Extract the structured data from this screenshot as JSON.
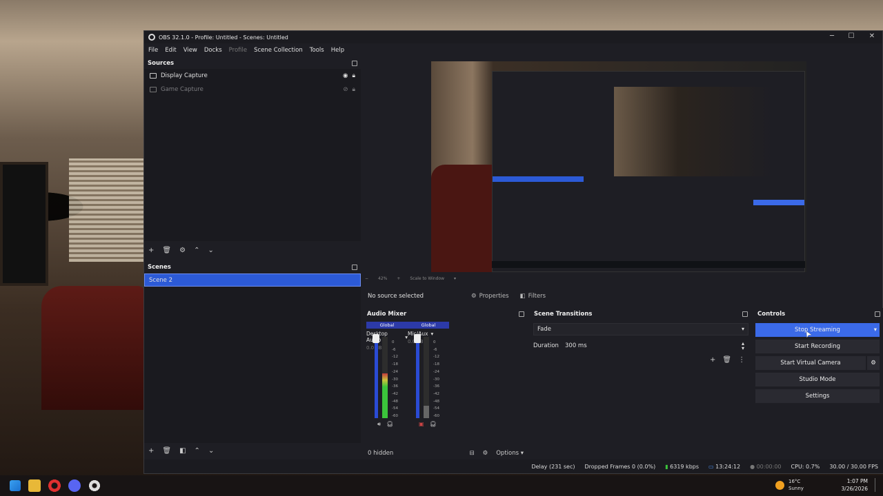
{
  "window": {
    "title": "OBS 32.1.0 - Profile: Untitled - Scenes: Untitled",
    "minimize": "─",
    "maximize": "☐",
    "close": "✕"
  },
  "menu": [
    "File",
    "Edit",
    "View",
    "Docks",
    "Profile",
    "Scene Collection",
    "Tools",
    "Help"
  ],
  "sources": {
    "title": "Sources",
    "items": [
      {
        "label": "Display Capture",
        "icon": "monitor-icon",
        "visible": true
      },
      {
        "label": "Game Capture",
        "icon": "gamepad-icon",
        "visible": false
      }
    ]
  },
  "scenes": {
    "title": "Scenes",
    "items": [
      {
        "label": "Scene 2",
        "selected": true
      }
    ]
  },
  "preview": {
    "zoom": "42%",
    "scale_mode": "Scale to Window"
  },
  "context_bar": {
    "no_source": "No source selected",
    "properties": "Properties",
    "filters": "Filters"
  },
  "audio_mixer": {
    "title": "Audio Mixer",
    "channels": [
      {
        "global": "Global",
        "name": "Desktop Audio",
        "db": "0.0 dB",
        "level": 0.55
      },
      {
        "global": "Global",
        "name": "Mic/Aux",
        "db": "0.0 dB",
        "level": 0.15
      }
    ],
    "ticks": [
      "0",
      "-6",
      "-12",
      "-18",
      "-24",
      "-30",
      "-36",
      "-42",
      "-48",
      "-54",
      "-60"
    ],
    "hidden": "0 hidden",
    "options": "Options"
  },
  "transitions": {
    "title": "Scene Transitions",
    "selected": "Fade",
    "duration_label": "Duration",
    "duration_value": "300 ms"
  },
  "controls": {
    "title": "Controls",
    "stop_streaming": "Stop Streaming",
    "start_recording": "Start Recording",
    "start_virtual_camera": "Start Virtual Camera",
    "studio_mode": "Studio Mode",
    "settings": "Settings"
  },
  "status": {
    "delay": "Delay (231 sec)",
    "dropped": "Dropped Frames 0 (0.0%)",
    "bitrate": "6319 kbps",
    "stream_time": "13:24:12",
    "record_time": "00:00:00",
    "cpu": "CPU: 0.7%",
    "fps": "30.00 / 30.00 FPS"
  },
  "taskbar": {
    "weather_temp": "16°C",
    "weather_text": "Sunny",
    "time": "1:07 PM",
    "date": "3/26/2026"
  },
  "colors": {
    "accent": "#3b6ae8",
    "selected": "#2c5ad6",
    "panel": "#1e1e24"
  }
}
